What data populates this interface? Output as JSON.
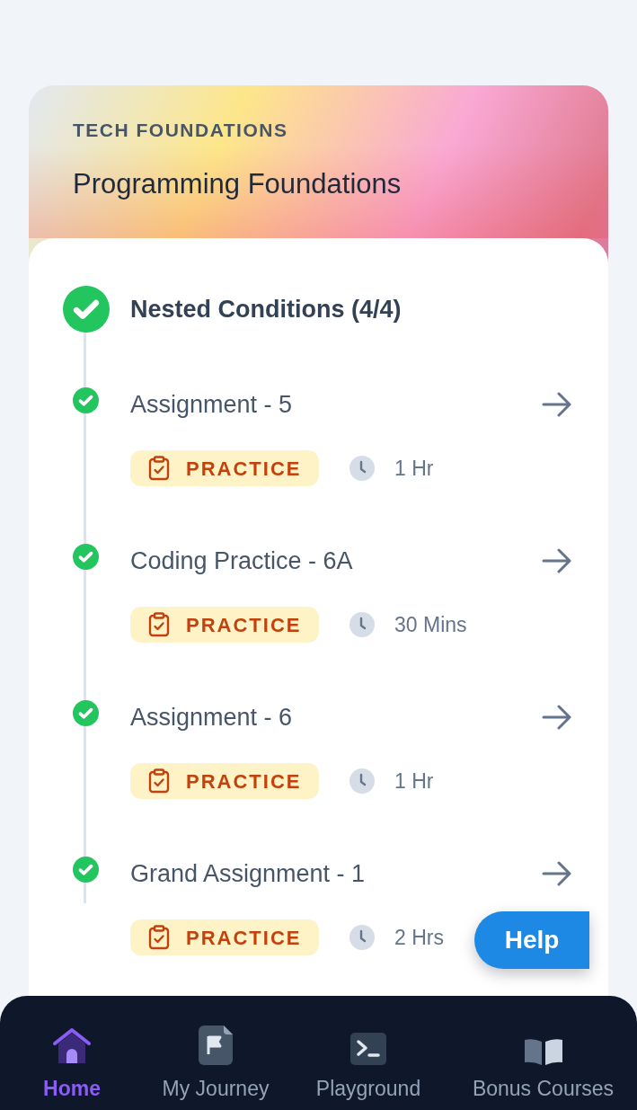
{
  "course": {
    "category": "TECH FOUNDATIONS",
    "title": "Programming Foundations"
  },
  "module": {
    "title": "Nested Conditions (4/4)",
    "completed": true
  },
  "items": [
    {
      "title": "Assignment - 5",
      "completed": true,
      "tag": "PRACTICE",
      "duration": "1 Hr"
    },
    {
      "title": "Coding Practice - 6A",
      "completed": true,
      "tag": "PRACTICE",
      "duration": "30 Mins"
    },
    {
      "title": "Assignment - 6",
      "completed": true,
      "tag": "PRACTICE",
      "duration": "1 Hr"
    },
    {
      "title": "Grand Assignment - 1",
      "completed": true,
      "tag": "PRACTICE",
      "duration": "2 Hrs"
    }
  ],
  "help_button": "Help",
  "nav": [
    {
      "label": "Home",
      "selected": true,
      "kind": "home"
    },
    {
      "label": "My Journey",
      "selected": false,
      "kind": "journey"
    },
    {
      "label": "Playground",
      "selected": false,
      "kind": "terminal"
    },
    {
      "label": "Bonus Courses",
      "selected": false,
      "kind": "book"
    }
  ]
}
